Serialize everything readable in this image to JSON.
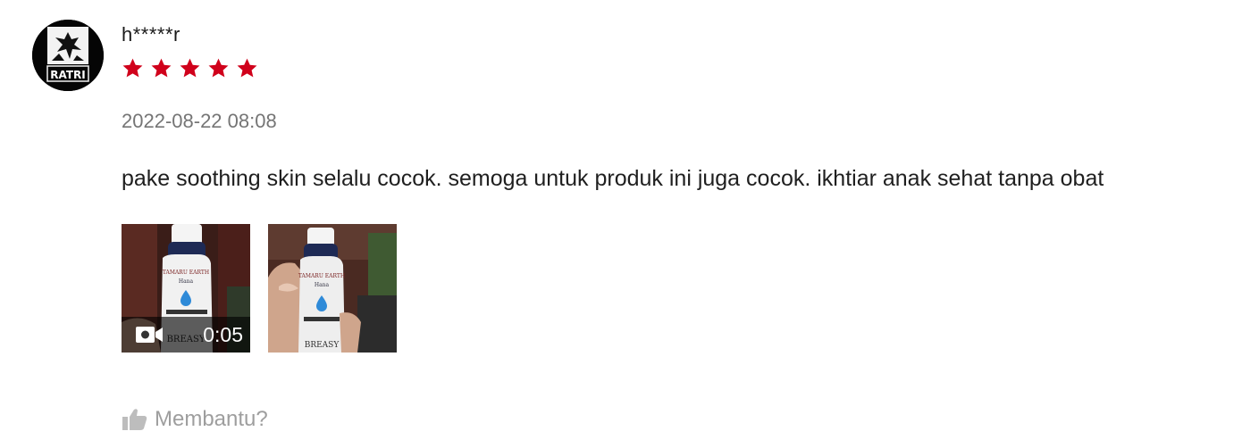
{
  "review": {
    "author": "h*****r",
    "avatar": {
      "text": "RATRI",
      "icon": "avatar-ratri-logo"
    },
    "rating": 5,
    "rating_max": 5,
    "date": "2022-08-22 08:08",
    "comment": "pake soothing skin selalu cocok. semoga untuk produk ini juga cocok. ikhtiar anak sehat tanpa obat",
    "media": [
      {
        "type": "video",
        "duration": "0:05",
        "icon": "video-camera-icon"
      },
      {
        "type": "photo"
      }
    ],
    "helpful": {
      "label": "Membantu?",
      "icon": "thumbs-up-icon"
    }
  },
  "colors": {
    "star": "#d0011b",
    "date": "#757575",
    "helpful": "#9e9e9e"
  }
}
